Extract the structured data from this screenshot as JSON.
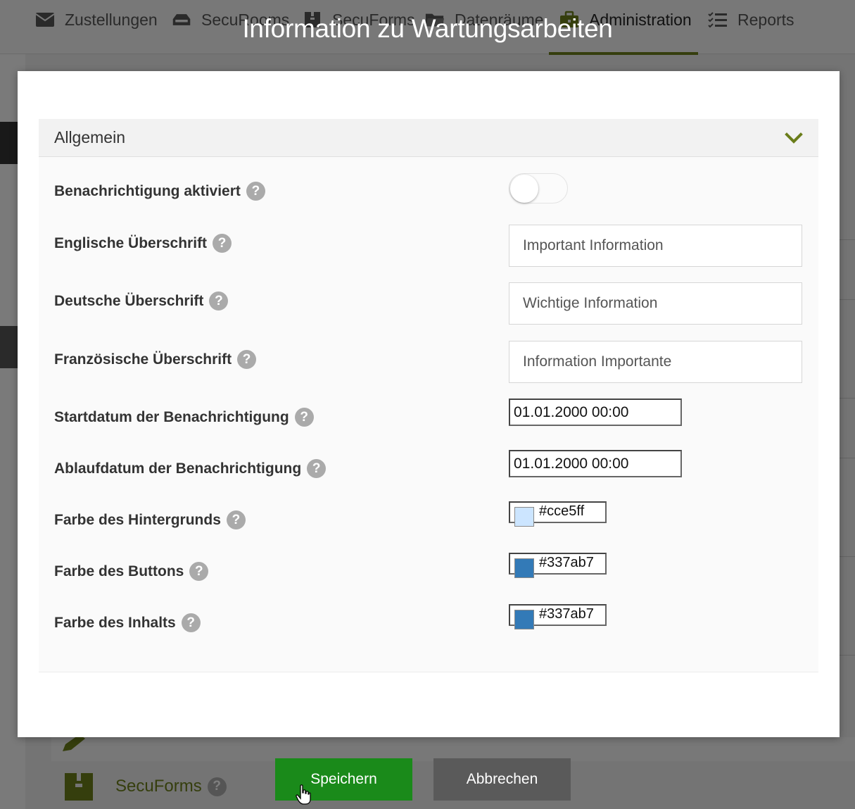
{
  "nav": {
    "items": [
      {
        "label": "Zustellungen",
        "icon": "envelope-icon"
      },
      {
        "label": "SecuRooms",
        "icon": "inbox-icon"
      },
      {
        "label": "SecuForms",
        "icon": "box-icon"
      },
      {
        "label": "Datenräume",
        "icon": "folder-icon"
      },
      {
        "label": "Administration",
        "icon": "briefcase-icon"
      },
      {
        "label": "Reports",
        "icon": "list-icon"
      }
    ],
    "active": "Administration"
  },
  "background": {
    "secuforms_label": "SecuForms"
  },
  "modal": {
    "title": "Information zu Wartungsarbeiten",
    "section_title": "Allgemein",
    "fields": {
      "enabled": {
        "label": "Benachrichtigung aktiviert",
        "value": false
      },
      "title_en": {
        "label": "Englische Überschrift",
        "value": "Important Information"
      },
      "title_de": {
        "label": "Deutsche Überschrift",
        "value": "Wichtige Information"
      },
      "title_fr": {
        "label": "Französische Überschrift",
        "value": "Information Importante"
      },
      "start_date": {
        "label": "Startdatum der Benachrichtigung",
        "value": "01.01.2000 00:00"
      },
      "end_date": {
        "label": "Ablaufdatum der Benachrichtigung",
        "value": "01.01.2000 00:00"
      },
      "bg_color": {
        "label": "Farbe des Hintergrunds",
        "value": "#cce5ff"
      },
      "button_color": {
        "label": "Farbe des Buttons",
        "value": "#337ab7"
      },
      "content_color": {
        "label": "Farbe des Inhalts",
        "value": "#337ab7"
      }
    },
    "help_glyph": "?"
  },
  "actions": {
    "save_label": "Speichern",
    "cancel_label": "Abbrechen"
  },
  "colors": {
    "accent": "#6a7d1a",
    "save": "#1a8a1a",
    "cancel": "#5a5a5a"
  }
}
